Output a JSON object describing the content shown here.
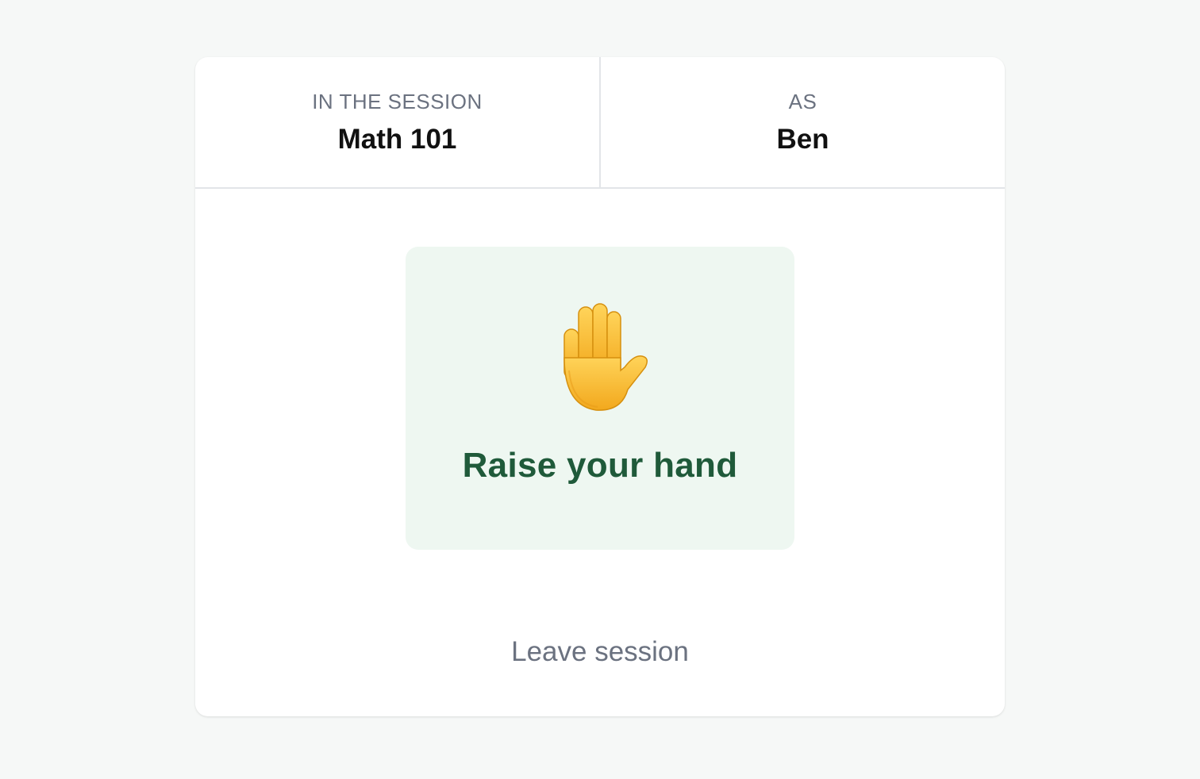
{
  "session": {
    "label": "IN THE SESSION",
    "name": "Math 101"
  },
  "identity": {
    "label": "AS",
    "name": "Ben"
  },
  "raise_hand": {
    "icon": "raised-hand-icon",
    "label": "Raise your hand",
    "background_color": "#eef7f1",
    "text_color": "#1f5a3a"
  },
  "leave": {
    "label": "Leave session"
  },
  "colors": {
    "page_background": "#f6f8f7",
    "card_background": "#ffffff",
    "muted_text": "#6b7280"
  }
}
